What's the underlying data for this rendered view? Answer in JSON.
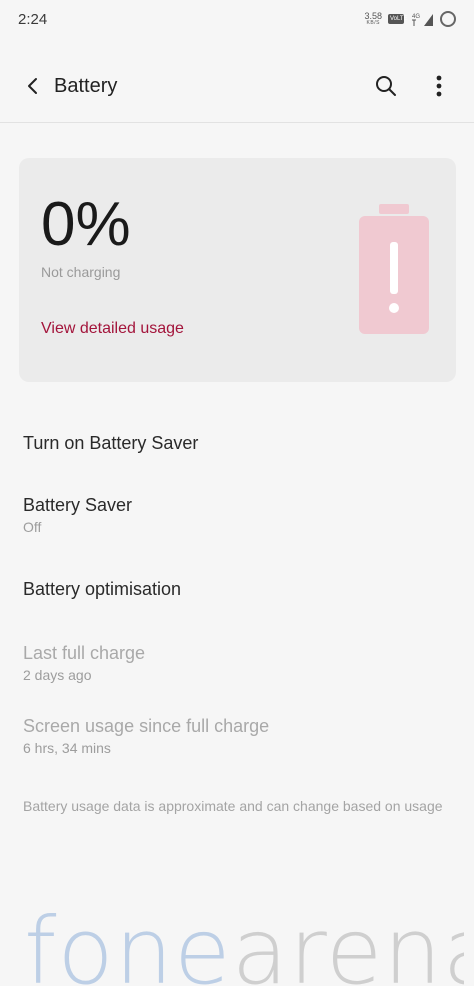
{
  "status": {
    "time": "2:24",
    "netspeed_value": "3.58",
    "netspeed_unit": "KB/S",
    "volte_label": "VoLTE",
    "network_type": "4G"
  },
  "appbar": {
    "title": "Battery",
    "back_icon": "back-arrow-icon",
    "search_icon": "search-icon",
    "more_icon": "more-vert-icon"
  },
  "battery_card": {
    "percent": "0%",
    "level": 0,
    "status": "Not charging",
    "link": "View detailed usage",
    "accent_color": "#a3143b",
    "battery_icon": "battery-alert-icon",
    "battery_color": "#f0c9d1"
  },
  "settings": [
    {
      "title": "Turn on Battery Saver",
      "subtitle": ""
    },
    {
      "title": "Battery Saver",
      "subtitle": "Off"
    },
    {
      "title": "Battery optimisation",
      "subtitle": ""
    },
    {
      "title": "Last full charge",
      "subtitle": "2 days ago"
    },
    {
      "title": "Screen usage since full charge",
      "subtitle": "6 hrs, 34 mins"
    }
  ],
  "footnote": "Battery usage data is approximate and can change based on usage",
  "watermark": {
    "part1": "fone",
    "part2": "arena"
  }
}
